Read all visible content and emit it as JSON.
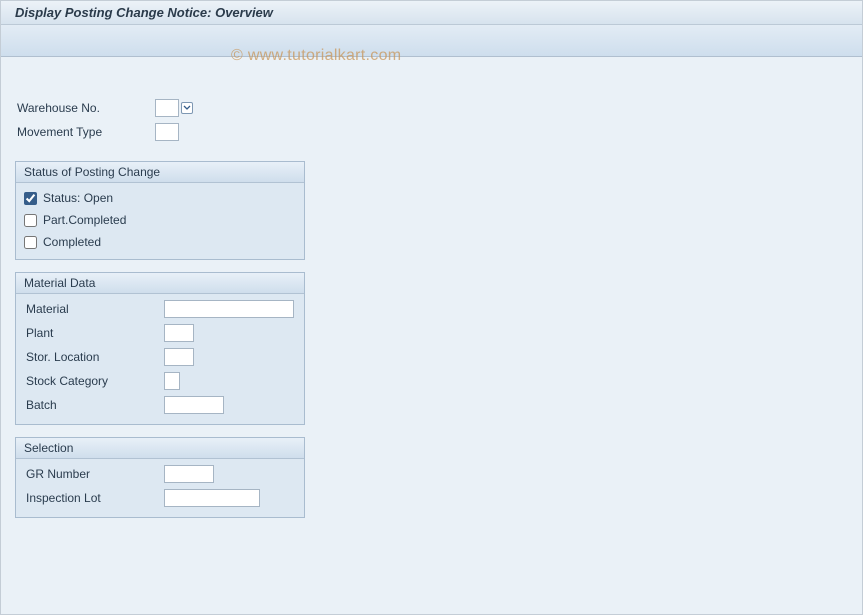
{
  "header": {
    "title": "Display Posting Change Notice: Overview"
  },
  "watermark": "© www.tutorialkart.com",
  "top_fields": {
    "warehouse_no": {
      "label": "Warehouse No.",
      "value": ""
    },
    "movement_type": {
      "label": "Movement Type",
      "value": ""
    }
  },
  "groups": {
    "status": {
      "title": "Status of Posting Change",
      "status_open": {
        "label": "Status: Open",
        "checked": true
      },
      "part_completed": {
        "label": "Part.Completed",
        "checked": false
      },
      "completed": {
        "label": "Completed",
        "checked": false
      }
    },
    "material": {
      "title": "Material Data",
      "material": {
        "label": "Material",
        "value": ""
      },
      "plant": {
        "label": "Plant",
        "value": ""
      },
      "stor_location": {
        "label": "Stor. Location",
        "value": ""
      },
      "stock_category": {
        "label": "Stock Category",
        "value": ""
      },
      "batch": {
        "label": "Batch",
        "value": ""
      }
    },
    "selection": {
      "title": "Selection",
      "gr_number": {
        "label": "GR Number",
        "value": ""
      },
      "inspection_lot": {
        "label": "Inspection Lot",
        "value": ""
      }
    }
  }
}
